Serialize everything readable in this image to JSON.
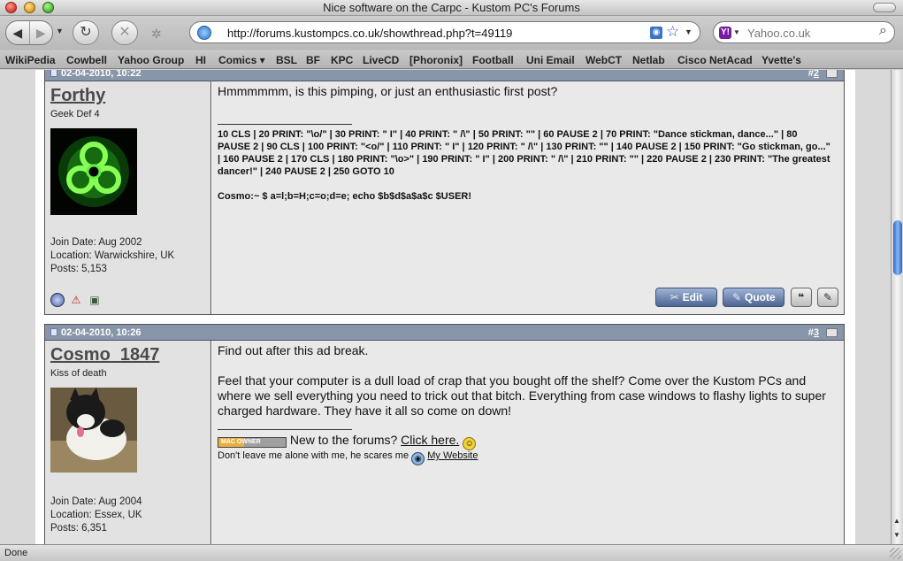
{
  "window": {
    "title": "Nice software on the Carpc - Kustom PC's Forums"
  },
  "toolbar": {
    "back_icon": "◀",
    "forward_icon": "▶",
    "reload_icon": "↻",
    "stop_icon": "✕",
    "url": "http://forums.kustompcs.co.uk/showthread.php?t=49119",
    "search_placeholder": "Yahoo.co.uk"
  },
  "bookmarks": [
    "WikiPedia",
    "Cowbell",
    "Yahoo Group",
    "HI",
    "Comics ▾",
    "BSL",
    "BF",
    "KPC",
    "LiveCD",
    "[Phoronix]",
    "Football",
    "Uni Email",
    "WebCT",
    "Netlab",
    "Cisco NetAcad",
    "Yvette's"
  ],
  "posts": [
    {
      "date": "02-04-2010, 10:22",
      "number_prefix": "#",
      "number": "2",
      "user": {
        "name": "Forthy",
        "title": "Geek Def 4",
        "join_date": "Join Date: Aug 2002",
        "location": "Location: Warwickshire, UK",
        "posts": "Posts: 5,153"
      },
      "message": "Hmmmmmm, is this pimping, or just an enthusiastic first post?",
      "signature_line1": "10 CLS | 20 PRINT: \"\\o/\" | 30 PRINT: \" I\" | 40 PRINT: \" /\\\" | 50 PRINT: \"\" | 60 PAUSE 2 | 70 PRINT: \"Dance stickman, dance...\" | 80 PAUSE 2 | 90 CLS | 100 PRINT: \"<o/\" | 110 PRINT: \" I\" | 120 PRINT: \" /\\\" | 130 PRINT: \"\" | 140 PAUSE 2 | 150 PRINT: \"Go stickman, go...\" | 160 PAUSE 2 | 170 CLS | 180 PRINT: \"\\o>\" | 190 PRINT: \" I\" | 200 PRINT: \" /\\\" | 210 PRINT: \"\" | 220 PAUSE 2 | 230 PRINT: \"The greatest dancer!\" | 240 PAUSE 2 | 250 GOTO 10",
      "signature_line2": "Cosmo:~ $ a=l;b=H;c=o;d=e; echo $b$d$a$a$c $USER!",
      "buttons": {
        "edit": "Edit",
        "quote": "Quote"
      }
    },
    {
      "date": "02-04-2010, 10:26",
      "number_prefix": "#",
      "number": "3",
      "user": {
        "name": "Cosmo_1847",
        "title": "Kiss of death",
        "join_date": "Join Date: Aug 2004",
        "location": "Location: Essex, UK",
        "posts": "Posts: 6,351"
      },
      "message_p1": "Find out after this ad break.",
      "message_p2": "Feel that your computer is a dull load of crap that you bought off the shelf? Come over the Kustom PCs and where we sell everything you need to trick out that bitch. Everything from case windows to flashy lights to super charged hardware. They have it all so come on down!",
      "badge": "MAC OWNER",
      "sig_text": "New to the forums?",
      "sig_link": "Click here.",
      "sig_small": "Don't leave me alone with me, he scares me",
      "sig_small_link": "My Website"
    }
  ],
  "status": "Done"
}
